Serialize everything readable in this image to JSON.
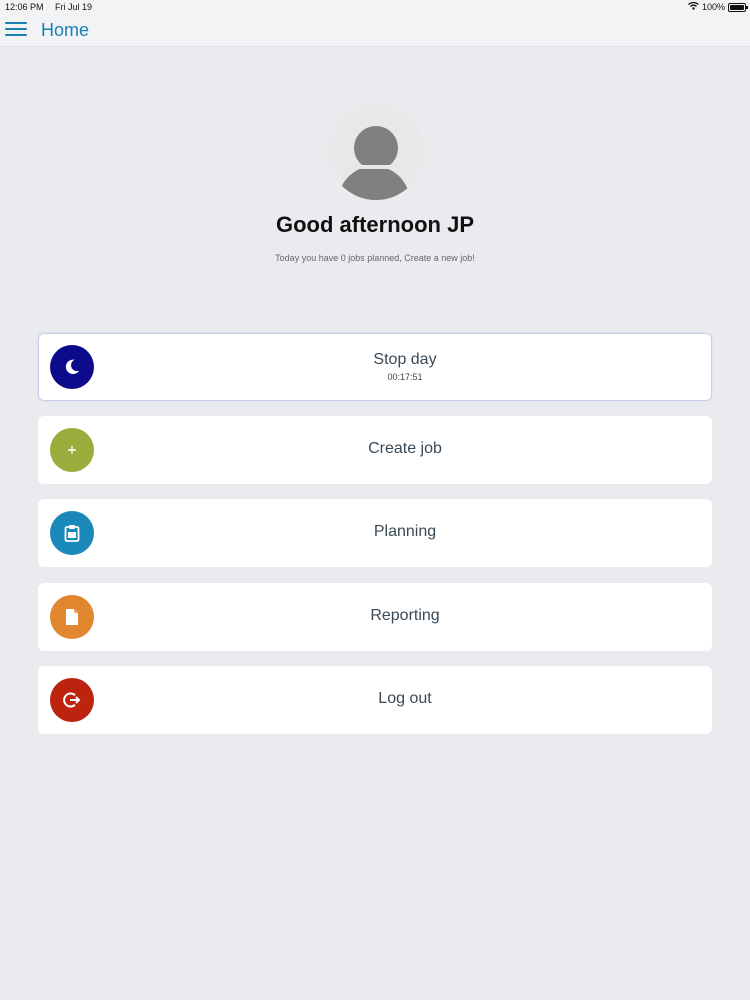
{
  "status_bar": {
    "time": "12:06 PM",
    "date": "Fri Jul 19",
    "battery": "100%"
  },
  "nav": {
    "title": "Home",
    "menu_icon": "hamburger-menu-icon"
  },
  "profile": {
    "avatar_icon": "user-avatar-icon",
    "greeting": "Good afternoon JP",
    "subtitle": "Today you have 0 jobs planned, Create a new job!"
  },
  "menu": [
    {
      "label": "Stop day",
      "sub": "00:17:51",
      "icon": "moon-icon",
      "color": "#0b0b8c"
    },
    {
      "label": "Create job",
      "icon": "plus-icon",
      "color": "#9aae3d"
    },
    {
      "label": "Planning",
      "icon": "clipboard-icon",
      "color": "#1a88b9"
    },
    {
      "label": "Reporting",
      "icon": "document-icon",
      "color": "#e0872f"
    },
    {
      "label": "Log out",
      "icon": "logout-icon",
      "color": "#bd2410"
    }
  ]
}
